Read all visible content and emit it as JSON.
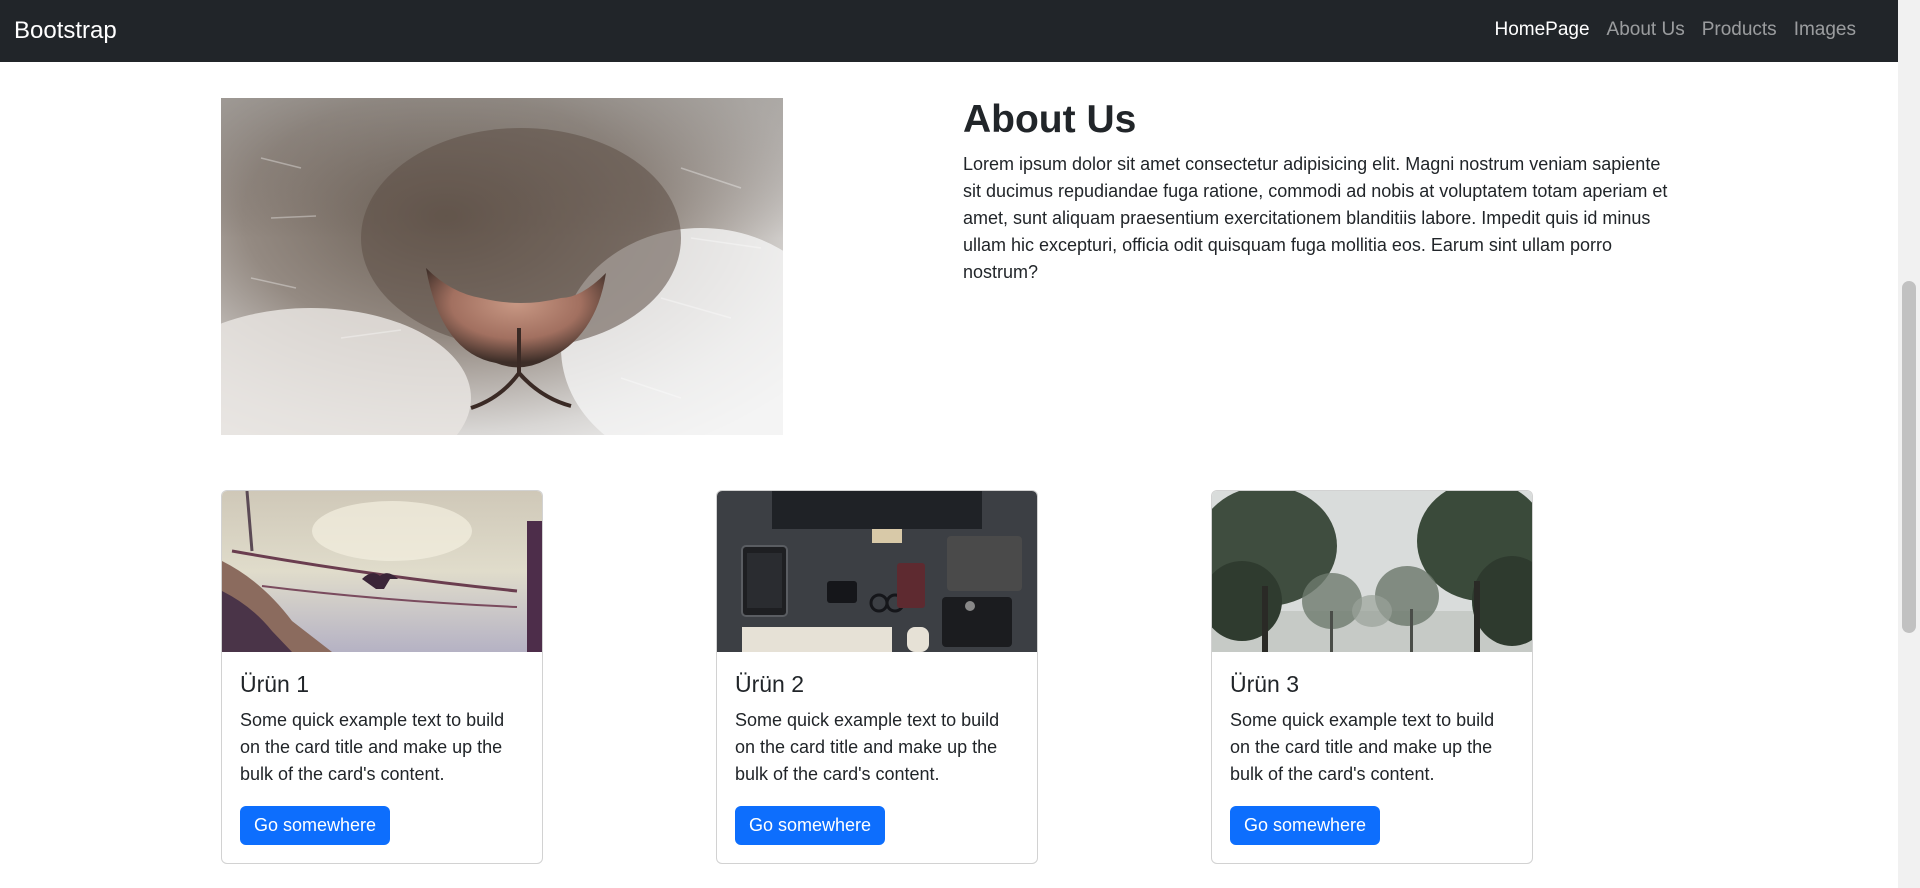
{
  "navbar": {
    "brand": "Bootstrap",
    "links": [
      "HomePage",
      "About Us",
      "Products",
      "Images"
    ],
    "active": "HomePage"
  },
  "about": {
    "title": "About Us",
    "text": "Lorem ipsum dolor sit amet consectetur adipisicing elit. Magni nostrum veniam sapiente sit ducimus repudiandae fuga ratione, commodi ad nobis at voluptatem totam aperiam et amet, sunt aliquam praesentium exercitationem blanditiis labore. Impedit quis id minus ullam hic excepturi, officia odit quisquam fuga mollitia eos. Earum sint ullam porro nostrum?"
  },
  "cards": [
    {
      "title": "Ürün 1",
      "text": "Some quick example text to build on the card title and make up the bulk of the card's content.",
      "button": "Go somewhere"
    },
    {
      "title": "Ürün 2",
      "text": "Some quick example text to build on the card title and make up the bulk of the card's content.",
      "button": "Go somewhere"
    },
    {
      "title": "Ürün 3",
      "text": "Some quick example text to build on the card title and make up the bulk of the card's content.",
      "button": "Go somewhere"
    }
  ],
  "colors": {
    "navbar_bg": "#212529",
    "primary": "#0d6efd"
  }
}
